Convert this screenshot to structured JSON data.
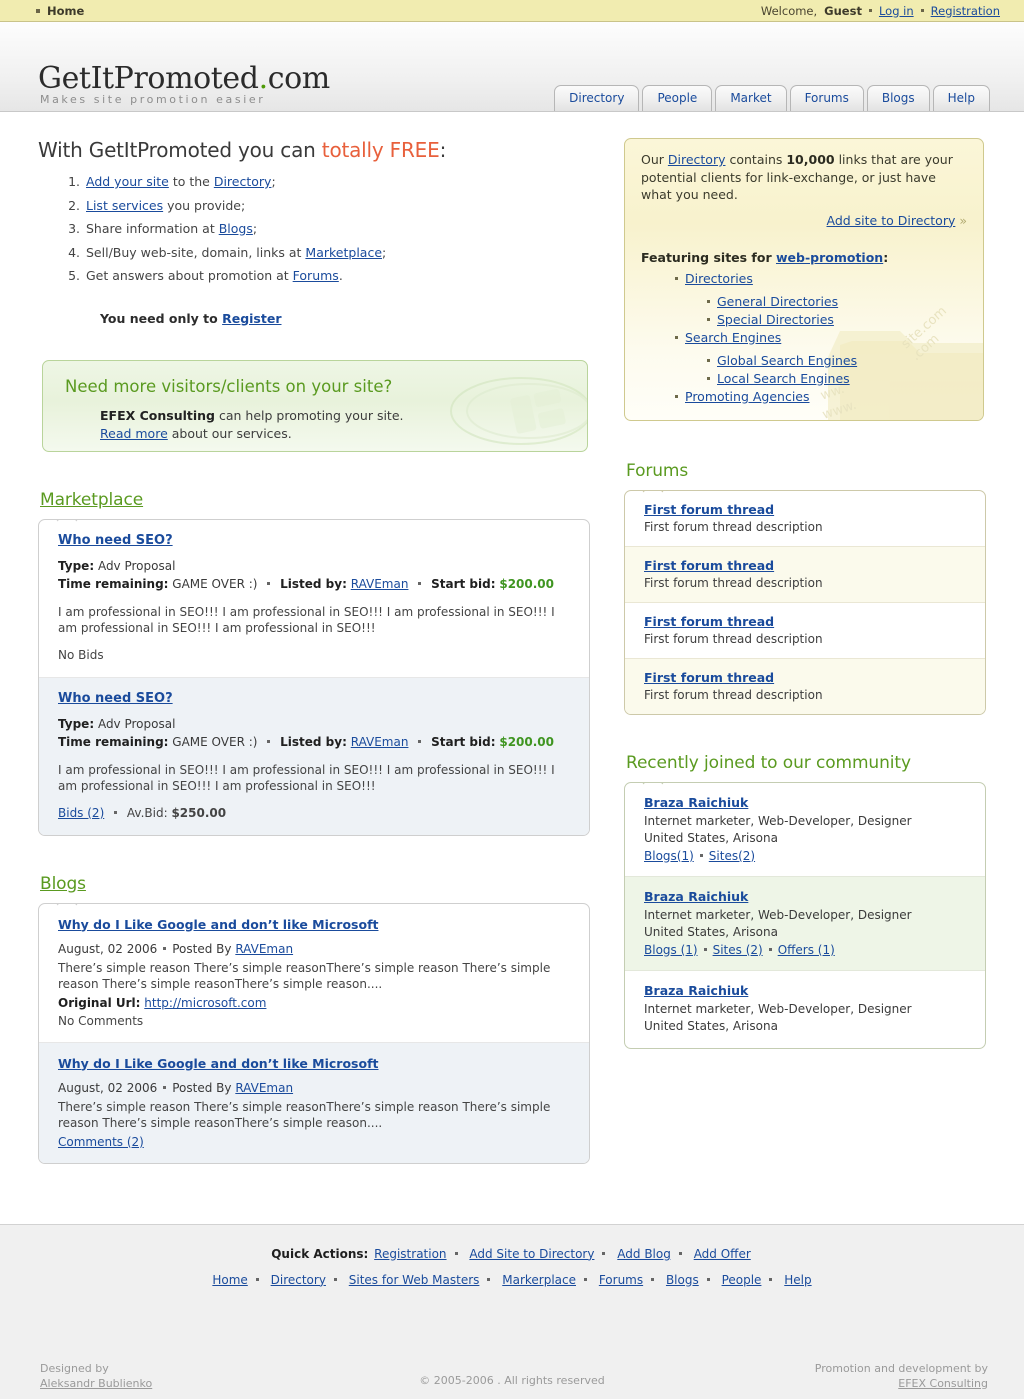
{
  "topbar": {
    "breadcrumb": "Home",
    "welcome": "Welcome,",
    "guest": "Guest",
    "login": "Log in",
    "registration": "Registration"
  },
  "header": {
    "logo_main": "GetItPromoted",
    "logo_dot": ".",
    "logo_tld": "com",
    "tagline": "Makes site promotion easier",
    "tabs": [
      {
        "label": "Directory"
      },
      {
        "label": "People"
      },
      {
        "label": "Market"
      },
      {
        "label": "Forums"
      },
      {
        "label": "Blogs"
      },
      {
        "label": "Help"
      }
    ]
  },
  "intro": {
    "heading_pre": "With GetItPromoted you can ",
    "heading_free": "totally FREE",
    "heading_post": ":",
    "steps": [
      {
        "link1": "Add your site",
        "mid": " to the ",
        "link2": "Directory",
        "end": ";"
      },
      {
        "link1": "List services",
        "mid": " you provide;",
        "link2": "",
        "end": ""
      },
      {
        "link1": "",
        "mid": "Share information at ",
        "link2": "Blogs",
        "end": ";"
      },
      {
        "link1": "",
        "mid": "Sell/Buy web-site, domain, links at ",
        "link2": "Marketplace",
        "end": ";"
      },
      {
        "link1": "",
        "mid": "Get answers about promotion at ",
        "link2": "Forums",
        "end": "."
      }
    ],
    "register_text": "You need only to ",
    "register_link": "Register"
  },
  "promo": {
    "heading": "Need more visitors/clients on your site?",
    "company": "EFEX Consulting",
    "line1_rest": " can help promoting your site.",
    "readmore": "Read more",
    "line2_rest": " about our services."
  },
  "directory_box": {
    "lead_pre": "Our ",
    "lead_link": "Directory",
    "lead_mid": " contains ",
    "lead_count": "10,000",
    "lead_post": " links that are your potential clients for link-exchange, or just have what you need.",
    "add_link": "Add site to Directory",
    "chevron": "»",
    "featuring_pre": "Featuring sites for ",
    "featuring_link": "web-promotion",
    "featuring_post": ":",
    "tree": [
      {
        "label": "Directories",
        "children": [
          "General Directories",
          "Special Directories"
        ]
      },
      {
        "label": "Search Engines",
        "children": [
          "Global Search Engines",
          "Local Search Engines"
        ]
      },
      {
        "label": "Promoting Agencies",
        "children": []
      }
    ]
  },
  "marketplace": {
    "heading": "Marketplace",
    "items": [
      {
        "title": "Who need SEO?",
        "type_label": "Type:",
        "type_value": " Adv Proposal",
        "time_label": "Time remaining:",
        "time_value": " GAME OVER :)",
        "listed_label": "Listed by:",
        "listed_value": "RAVEman",
        "bid_label": "Start bid:",
        "bid_value": "$200.00",
        "description": "I am professional in SEO!!! I am professional in SEO!!! I am professional in SEO!!! I am professional in SEO!!! I am professional in SEO!!!",
        "footer_plain": "No Bids",
        "footer_link": "",
        "footer_avbid_label": "",
        "footer_avbid_value": ""
      },
      {
        "title": "Who need SEO?",
        "type_label": "Type:",
        "type_value": " Adv Proposal",
        "time_label": "Time remaining:",
        "time_value": " GAME OVER :)",
        "listed_label": "Listed by:",
        "listed_value": "RAVEman",
        "bid_label": "Start bid:",
        "bid_value": "$200.00",
        "description": "I am professional in SEO!!! I am professional in SEO!!! I am professional in SEO!!! I am professional in SEO!!! I am professional in SEO!!!",
        "footer_plain": "",
        "footer_link": "Bids (2)",
        "footer_avbid_label": "Av.Bid: ",
        "footer_avbid_value": "$250.00"
      }
    ]
  },
  "blogs": {
    "heading": "Blogs",
    "items": [
      {
        "title": "Why do I Like Google and don’t like Microsoft",
        "date": "August, 02 2006",
        "posted_by_label": "Posted By ",
        "author": "RAVEman",
        "body": "There’s simple reason There’s simple reasonThere’s simple reason There’s simple reason There’s simple reasonThere’s simple reason....",
        "url_label": "Original Url:",
        "url_value": "http://microsoft.com",
        "comments_plain": "No Comments",
        "comments_link": ""
      },
      {
        "title": "Why do I Like Google and don’t like Microsoft",
        "date": "August, 02 2006",
        "posted_by_label": "Posted By ",
        "author": "RAVEman",
        "body": "There’s simple reason There’s simple reasonThere’s simple reason There’s simple reason There’s simple reasonThere’s simple reason....",
        "url_label": "",
        "url_value": "",
        "comments_plain": "",
        "comments_link": "Comments (2)"
      }
    ]
  },
  "forums": {
    "heading": "Forums",
    "threads": [
      {
        "title": "First forum thread",
        "description": "First forum thread description"
      },
      {
        "title": "First forum thread",
        "description": "First forum thread description"
      },
      {
        "title": "First forum thread",
        "description": "First forum thread description"
      },
      {
        "title": "First forum thread",
        "description": "First forum thread description"
      }
    ]
  },
  "community": {
    "heading": "Recently joined to our community",
    "people": [
      {
        "name": "Braza Raichiuk",
        "role": "Internet marketer, Web-Developer, Designer",
        "location": "United States, Arisona",
        "links": [
          "Blogs(1)",
          "Sites(2)"
        ]
      },
      {
        "name": "Braza Raichiuk",
        "role": "Internet marketer, Web-Developer, Designer",
        "location": "United States, Arisona",
        "links": [
          "Blogs (1)",
          "Sites (2)",
          "Offers (1)"
        ]
      },
      {
        "name": "Braza Raichiuk",
        "role": "Internet marketer, Web-Developer, Designer",
        "location": "United States, Arisona",
        "links": []
      }
    ]
  },
  "footer": {
    "quick_actions_label": "Quick Actions:",
    "quick_actions": [
      "Registration",
      "Add Site to Directory",
      "Add Blog",
      "Add Offer"
    ],
    "nav": [
      "Home",
      "Directory",
      "Sites for Web Masters",
      "Markerplace",
      "Forums",
      "Blogs",
      "People",
      "Help"
    ],
    "designed_by_label": "Designed by",
    "designed_by_name": "Aleksandr Bublienko",
    "promo_label": "Promotion and development by",
    "promo_name": "EFEX Consulting",
    "copyright": "© 2005-2006 . All rights reserved"
  },
  "colors": {
    "topbar_bg": "#f1ecb0",
    "green": "#5a9a20",
    "link": "#1a4b9c",
    "orange": "#e8603c",
    "price_green": "#3f9521"
  }
}
